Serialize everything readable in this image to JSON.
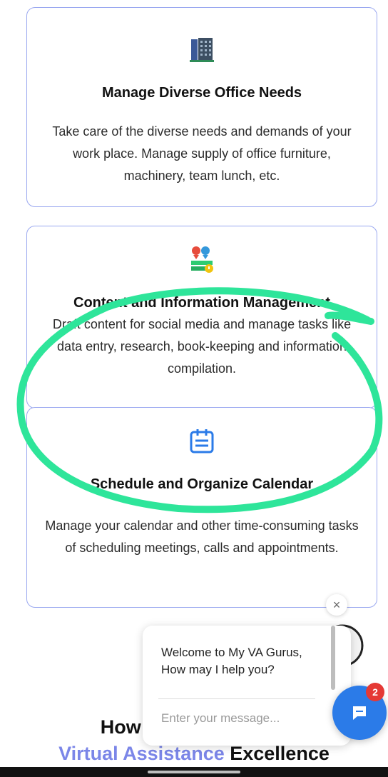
{
  "cards": [
    {
      "icon": "office-building-icon",
      "title": "Manage Diverse Office Needs",
      "text": "Take care of the diverse needs and demands of your work place. Manage supply of office furniture, machinery, team lunch, etc."
    },
    {
      "icon": "content-management-icon",
      "title": "Content and Information Management",
      "text": "Draft content for social media and manage tasks like data entry, research, book-keeping and information compilation."
    },
    {
      "icon": "calendar-icon",
      "title": "Schedule and Organize Calendar",
      "text": "Manage your calendar and other time-consuming tasks of scheduling meetings, calls and appointments."
    }
  ],
  "section_heading": {
    "line1": "How Our",
    "line2_accent": "Virtual Assistance",
    "line2_rest": " Excellence"
  },
  "chat": {
    "welcome": "Welcome to My VA Gurus,\nHow may I help you?",
    "input_placeholder": "Enter your message...",
    "close_label": "×",
    "badge_count": "2"
  },
  "colors": {
    "card_border": "#9aa8f0",
    "accent": "#7b86e8",
    "scribble": "#2ee59a",
    "chat_button": "#2b7be8",
    "badge": "#e53935"
  }
}
